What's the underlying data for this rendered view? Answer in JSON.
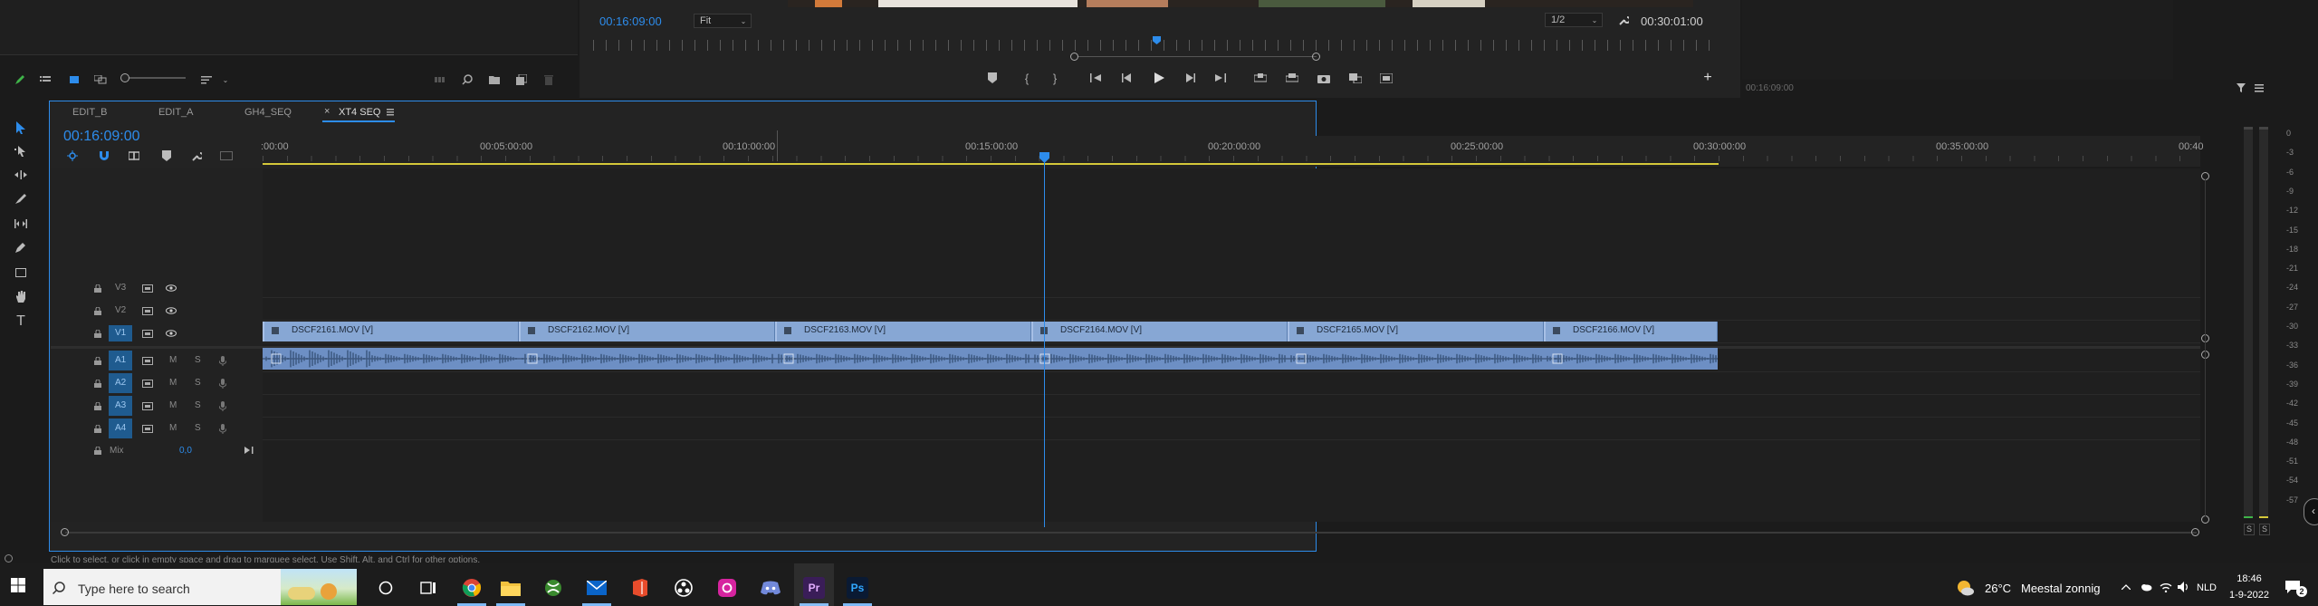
{
  "program": {
    "timecode": "00:16:09:00",
    "fit_label": "Fit",
    "resolution": "1/2",
    "duration": "00:30:01:00"
  },
  "source_panel": {
    "timecode": "00:16:09:00"
  },
  "sequence_tabs": [
    {
      "label": "EDIT_B",
      "active": false
    },
    {
      "label": "EDIT_A",
      "active": false
    },
    {
      "label": "GH4_SEQ",
      "active": false
    },
    {
      "label": "XT4 SEQ",
      "active": true
    }
  ],
  "tab_close_symbol": "×",
  "timeline": {
    "playhead_timecode": "00:16:09:00",
    "ruler_labels": [
      ":00:00",
      "00:05:00:00",
      "00:10:00:00",
      "00:15:00:00",
      "00:20:00:00",
      "00:25:00:00",
      "00:30:00:00",
      "00:35:00:00",
      "00:40"
    ],
    "video_tracks": [
      "V3",
      "V2",
      "V1"
    ],
    "audio_tracks": [
      "A1",
      "A2",
      "A3",
      "A4"
    ],
    "mute_label": "M",
    "solo_label": "S",
    "mix_label": "Mix",
    "mix_value": "0,0",
    "clips": [
      "DSCF2161.MOV [V]",
      "DSCF2162.MOV [V]",
      "DSCF2163.MOV [V]",
      "DSCF2164.MOV [V]",
      "DSCF2165.MOV [V]",
      "DSCF2166.MOV [V]"
    ]
  },
  "meter": {
    "ticks": [
      "0",
      "-3",
      "-6",
      "-9",
      "-12",
      "-15",
      "-18",
      "-21",
      "-24",
      "-27",
      "-30",
      "-33",
      "-36",
      "-39",
      "-42",
      "-45",
      "-48",
      "-51",
      "-54",
      "-57"
    ],
    "solo_left": "S",
    "solo_right": "S"
  },
  "status_bar": {
    "text": "Click to select, or click in empty space and drag to marquee select. Use Shift, Alt, and Ctrl for other options."
  },
  "taskbar": {
    "search_placeholder": "Type here to search",
    "weather_temp": "26°C",
    "weather_desc": "Meestal zonnig",
    "language": "NLD",
    "time": "18:46",
    "date": "1-9-2022",
    "notification_count": "2",
    "apps": [
      "cortana",
      "task-view",
      "chrome",
      "file-explorer",
      "xbox",
      "mail",
      "office",
      "davinci",
      "instagram",
      "discord",
      "premiere",
      "photoshop"
    ]
  },
  "colors": {
    "accent_blue": "#2d8ceb",
    "clip_video": "#87a7d4",
    "clip_audio": "#6d8fc4",
    "work_area": "#d4c83a",
    "track_target": "#1f5b8f"
  }
}
